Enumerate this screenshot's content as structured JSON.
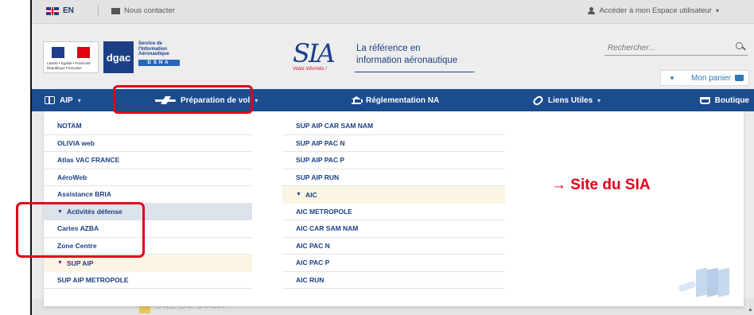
{
  "topbar": {
    "lang": "EN",
    "contact": "Nous contacter",
    "account": "Accéder à mon Espace utilisateur"
  },
  "header": {
    "logo_service": "Service de l'Information Aéronautique",
    "logo_dgac": "dgac",
    "logo_dsna": "DSNA",
    "sia_mark": "SIA",
    "sia_slogan": "Volez informés !",
    "sia_tagline_1": "La référence en",
    "sia_tagline_2": "information aéronautique",
    "search_placeholder": "Rechercher...",
    "cart": "Mon panier"
  },
  "nav": {
    "aip": "AIP",
    "preparation": "Préparation de vol",
    "reglementation": "Réglementation NA",
    "liens": "Liens Utiles",
    "boutique": "Boutique"
  },
  "menu_col_a": [
    {
      "label": "NOTAM"
    },
    {
      "label": "OLIVIA web"
    },
    {
      "label": "Atlas VAC FRANCE"
    },
    {
      "label": "AéroWeb"
    },
    {
      "label": "Assistance BRIA"
    },
    {
      "label": "Activités défense",
      "group": true
    },
    {
      "label": "Cartes AZBA"
    },
    {
      "label": "Zone Centre"
    },
    {
      "label": "SUP AIP",
      "group": true,
      "alt": true
    },
    {
      "label": "SUP AIP METROPOLE"
    }
  ],
  "menu_col_b": [
    {
      "label": "SUP AIP CAR SAM NAM"
    },
    {
      "label": "SUP AIP PAC N"
    },
    {
      "label": "SUP AIP PAC P"
    },
    {
      "label": "SUP AIP RUN"
    },
    {
      "label": "AIC",
      "group": true
    },
    {
      "label": "AIC METROPOLE"
    },
    {
      "label": "AIC CAR SAM NAM"
    },
    {
      "label": "AIC PAC N"
    },
    {
      "label": "AIC PAC P"
    },
    {
      "label": "AIC RUN"
    }
  ],
  "annotation": "→ Site du SIA",
  "background_heading": "UNE DU JOUR",
  "colors": {
    "nav_blue": "#1b4c8e",
    "highlight_red": "#e0001a",
    "menu_text": "#1b3f86"
  }
}
